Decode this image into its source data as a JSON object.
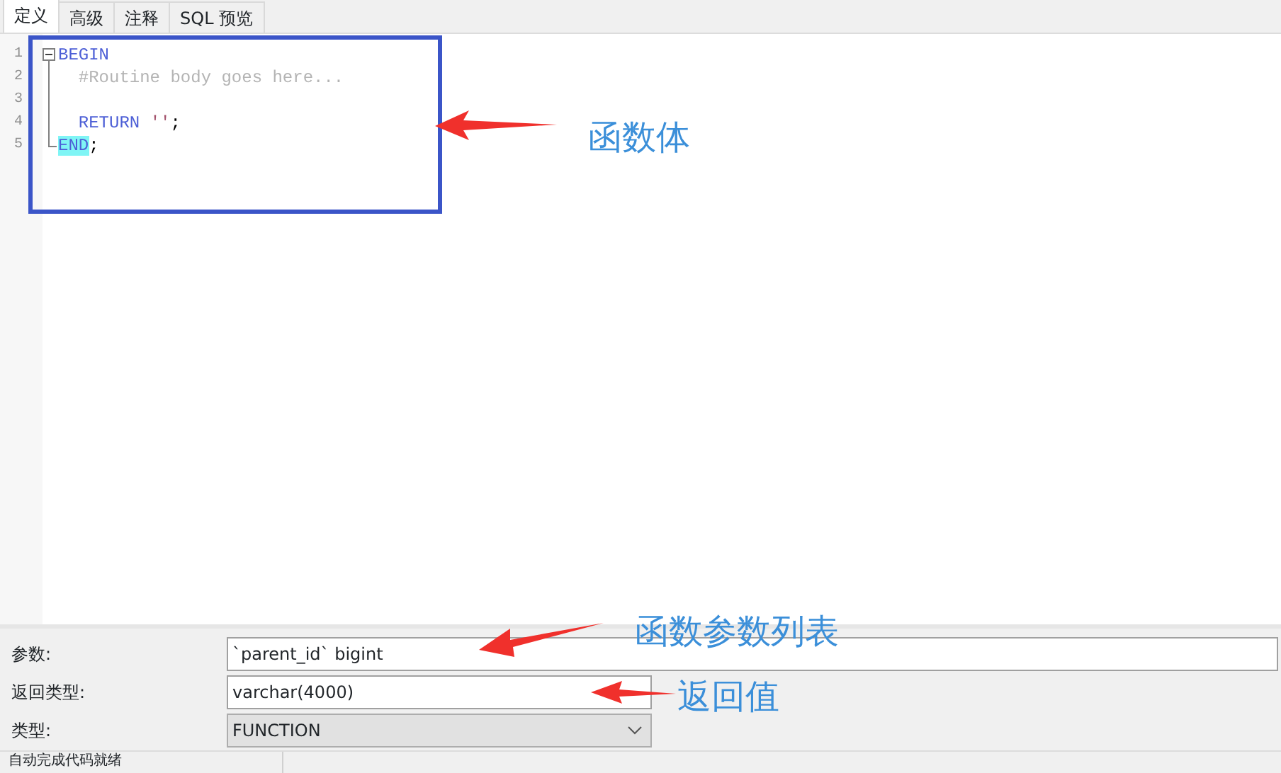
{
  "tabs": [
    {
      "label": "定义",
      "selected": true
    },
    {
      "label": "高级",
      "selected": false
    },
    {
      "label": "注释",
      "selected": false
    },
    {
      "label": "SQL 预览",
      "selected": false
    }
  ],
  "editor": {
    "lines": [
      {
        "number": "1",
        "kind": "fold-start",
        "tokens": [
          {
            "text": "BEGIN",
            "kind": "keyword",
            "highlighted": false
          }
        ]
      },
      {
        "number": "2",
        "kind": "fold-line",
        "tokens": [
          {
            "text": "  #Routine body goes here...",
            "kind": "comment",
            "highlighted": false
          }
        ]
      },
      {
        "number": "3",
        "kind": "fold-line"
      },
      {
        "number": "4",
        "kind": "fold-line",
        "tokens": [
          {
            "text": "  RETURN ",
            "kind": "keyword",
            "highlighted": false
          },
          {
            "text": "''",
            "kind": "string",
            "highlighted": false
          },
          {
            "text": ";",
            "kind": "plain",
            "highlighted": false
          }
        ]
      },
      {
        "number": "5",
        "kind": "fold-end",
        "tokens": [
          {
            "text": "END",
            "kind": "keyword",
            "highlighted": true
          },
          {
            "text": ";",
            "kind": "plain",
            "highlighted": false
          }
        ]
      }
    ]
  },
  "fields": [
    {
      "label": "参数:",
      "value": "`parent_id` bigint",
      "kind": "text"
    },
    {
      "label": "返回类型:",
      "value": "varchar(4000)",
      "kind": "text"
    },
    {
      "label": "类型:",
      "value": "FUNCTION",
      "kind": "select"
    }
  ],
  "status_bar": {
    "text": "自动完成代码就绪"
  },
  "annotations": [
    {
      "text": "函数体"
    },
    {
      "text": "函数参数列表"
    },
    {
      "text": "返回值"
    }
  ]
}
